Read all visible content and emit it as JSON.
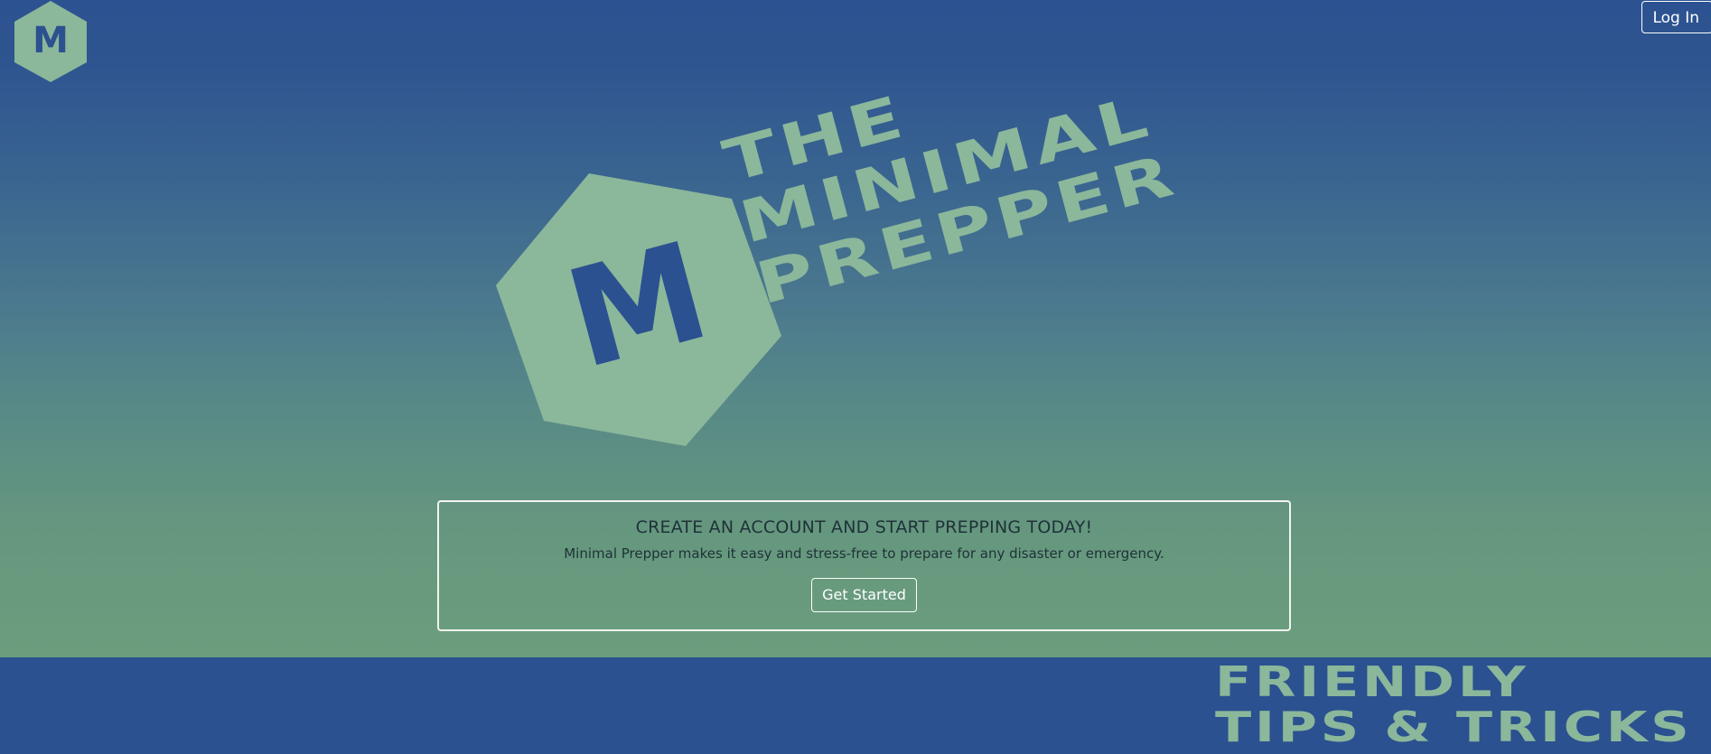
{
  "header": {
    "logo_letter": "M",
    "login_label": "Log In"
  },
  "hero": {
    "logo_letter": "M",
    "title_lines": [
      "THE",
      "MINIMAL",
      "PREPPER"
    ]
  },
  "cta": {
    "heading": "CREATE AN ACCOUNT AND START PREPPING TODAY!",
    "text": "Minimal Prepper makes it easy and stress-free to prepare for any disaster or emergency.",
    "button_label": "Get Started"
  },
  "tips": {
    "line1": "FRIENDLY",
    "line2": "TIPS & TRICKS"
  },
  "colors": {
    "brand_blue": "#2b5190",
    "brand_green": "#8bb79b",
    "text_dark": "#1f3138"
  }
}
